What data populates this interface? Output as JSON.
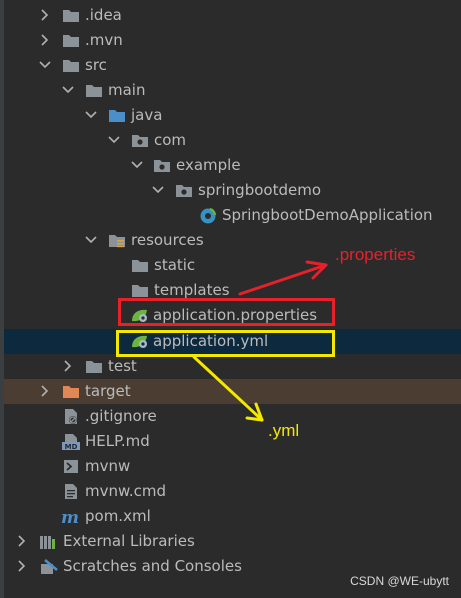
{
  "tree": {
    "items": [
      {
        "label": ".idea",
        "icon": "folder-icon"
      },
      {
        "label": ".mvn",
        "icon": "folder-icon"
      },
      {
        "label": "src",
        "icon": "folder-icon"
      },
      {
        "label": "main",
        "icon": "folder-icon"
      },
      {
        "label": "java",
        "icon": "source-folder-icon"
      },
      {
        "label": "com",
        "icon": "package-icon"
      },
      {
        "label": "example",
        "icon": "package-icon"
      },
      {
        "label": "springbootdemo",
        "icon": "package-icon"
      },
      {
        "label": "SpringbootDemoApplication",
        "icon": "spring-boot-class-icon"
      },
      {
        "label": "resources",
        "icon": "resources-folder-icon"
      },
      {
        "label": "static",
        "icon": "folder-icon"
      },
      {
        "label": "templates",
        "icon": "folder-icon"
      },
      {
        "label": "application.properties",
        "icon": "spring-config-icon"
      },
      {
        "label": "application.yml",
        "icon": "spring-config-icon",
        "selected": true
      },
      {
        "label": "test",
        "icon": "folder-icon"
      },
      {
        "label": "target",
        "icon": "excluded-folder-icon"
      },
      {
        "label": ".gitignore",
        "icon": "gitignore-file-icon"
      },
      {
        "label": "HELP.md",
        "icon": "markdown-file-icon",
        "badge": "MD"
      },
      {
        "label": "mvnw",
        "icon": "terminal-file-icon"
      },
      {
        "label": "mvnw.cmd",
        "icon": "text-file-icon"
      },
      {
        "label": "pom.xml",
        "icon": "maven-file-icon"
      },
      {
        "label": "External Libraries",
        "icon": "libraries-icon"
      },
      {
        "label": "Scratches and Consoles",
        "icon": "scratches-icon"
      }
    ]
  },
  "annotations": {
    "properties_label": ".properties",
    "yml_label": ".yml",
    "properties_color": "#e8202a",
    "yml_color": "#f5e800"
  },
  "watermark": "CSDN @WE-ubytt",
  "colors": {
    "background": "#2b2b2b",
    "selection": "#0d293e",
    "excluded_row": "#4b3d32",
    "text": "#bbbbbb"
  }
}
